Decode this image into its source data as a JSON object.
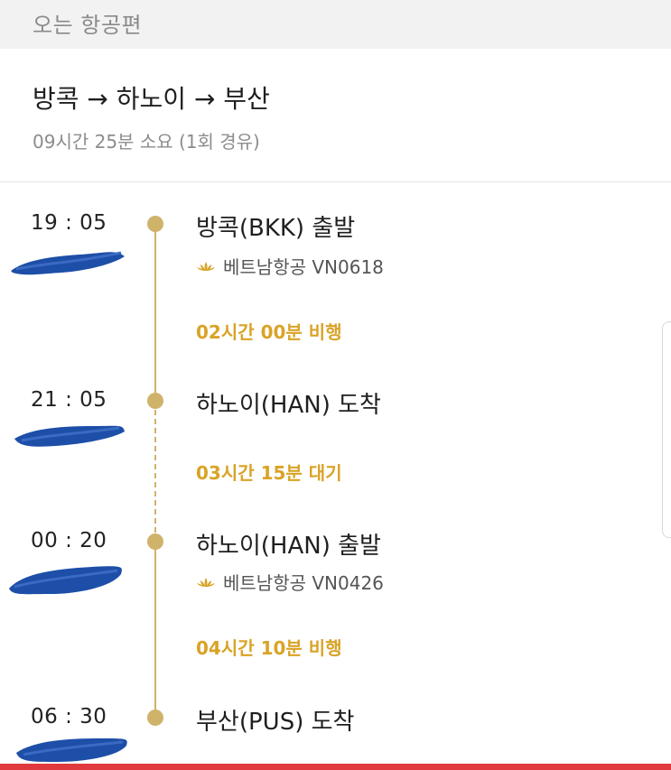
{
  "section": {
    "title": "오는 항공편"
  },
  "route": {
    "title": "방콕 → 하노이 → 부산",
    "summary": "09시간 25분 소요 (1회 경유)"
  },
  "timeline": [
    {
      "time": "19 : 05",
      "event": "방콕(BKK) 출발",
      "airline_icon": "lotus-icon",
      "flight": "베트남항공 VN0618"
    },
    {
      "duration": "02시간 00분 비행"
    },
    {
      "time": "21 : 05",
      "event": "하노이(HAN) 도착"
    },
    {
      "duration": "03시간 15분 대기"
    },
    {
      "time": "00 : 20",
      "event": "하노이(HAN) 출발",
      "airline_icon": "lotus-icon",
      "flight": "베트남항공 VN0426"
    },
    {
      "duration": "04시간 10분 비행"
    },
    {
      "time": "06 : 30",
      "event": "부산(PUS) 도착"
    }
  ],
  "colors": {
    "accent": "#cfb36a",
    "duration_text": "#d9a326",
    "redaction": "#1d4fa8",
    "bottom_bar": "#e0393e"
  }
}
